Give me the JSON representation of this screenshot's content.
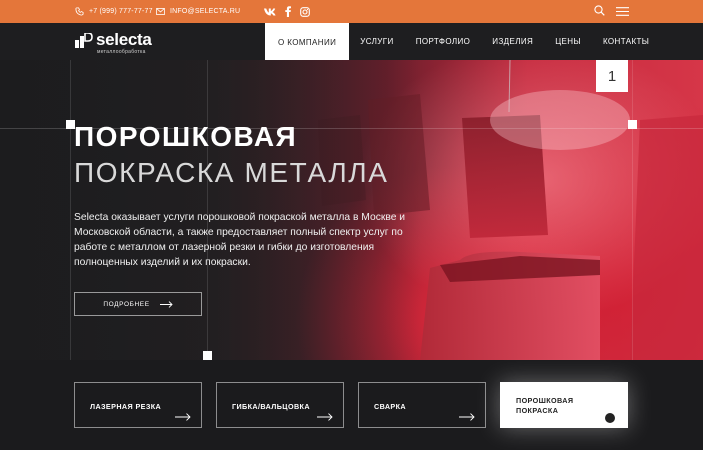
{
  "topbar": {
    "phone": "+7 (999) 777-77-77",
    "email": "INFO@SELECTA.RU",
    "socials": [
      "vk-icon",
      "facebook-icon",
      "instagram-icon"
    ],
    "icons": [
      "search-icon",
      "menu-icon"
    ],
    "bg_color": "#e4763a"
  },
  "header": {
    "logo_name": "selecta",
    "logo_sub": "металлообработка",
    "nav": [
      "О КОМПАНИИ",
      "УСЛУГИ",
      "ПОРТФОЛИО",
      "ИЗДЕЛИЯ",
      "ЦЕНЫ",
      "КОНТАКТЫ"
    ],
    "active_nav": "О КОМПАНИИ"
  },
  "hero": {
    "slide_number": "1",
    "title_line1": "ПОРОШКОВАЯ",
    "title_line2": "ПОКРАСКА МЕТАЛЛА",
    "description": "Selecta оказывает услуги порошковой покраской металла в Москве и Московской области, а также предоставляет полный спектр услуг по работе с металлом от лазерной резки и гибки до изготовления полноценных изделий и их покраски.",
    "more_button": "ПОДРОБНЕЕ"
  },
  "services": [
    {
      "label": "ЛАЗЕРНАЯ РЕЗКА",
      "active": false
    },
    {
      "label": "ГИБКА/ВАЛЬЦОВКА",
      "active": false
    },
    {
      "label": "СВАРКА",
      "active": false
    },
    {
      "label": "ПОРОШКОВАЯ ПОКРАСКА",
      "active": true
    }
  ]
}
